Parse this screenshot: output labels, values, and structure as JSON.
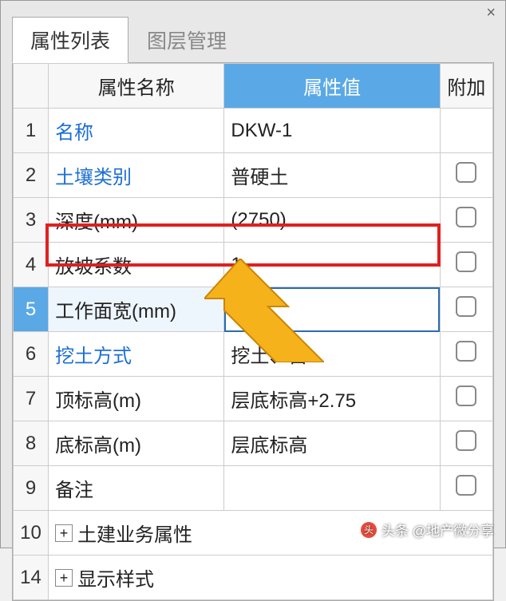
{
  "close_glyph": "×",
  "tabs": {
    "active": "属性列表",
    "inactive": "图层管理"
  },
  "headers": {
    "name": "属性名称",
    "value": "属性值",
    "add": "附加"
  },
  "rows": [
    {
      "n": "1",
      "name": "名称",
      "value": "DKW-1",
      "link": true,
      "checkbox": false
    },
    {
      "n": "2",
      "name": "土壤类别",
      "value": "普硬土",
      "link": true,
      "checkbox": true
    },
    {
      "n": "3",
      "name": "深度(mm)",
      "value": "(2750)",
      "link": false,
      "checkbox": true
    },
    {
      "n": "4",
      "name": "放坡系数",
      "value": "1",
      "link": false,
      "checkbox": true
    },
    {
      "n": "5",
      "name": "工作面宽(mm)",
      "value": "",
      "link": false,
      "checkbox": true,
      "selected": true
    },
    {
      "n": "6",
      "name": "挖土方式",
      "value": "挖土、自...",
      "link": true,
      "checkbox": true
    },
    {
      "n": "7",
      "name": "顶标高(m)",
      "value": "层底标高+2.75",
      "link": false,
      "checkbox": true
    },
    {
      "n": "8",
      "name": "底标高(m)",
      "value": "层底标高",
      "link": false,
      "checkbox": true
    },
    {
      "n": "9",
      "name": "备注",
      "value": "",
      "link": false,
      "checkbox": true
    },
    {
      "n": "10",
      "name": "土建业务属性",
      "value": "",
      "link": false,
      "checkbox": false,
      "expand": true
    },
    {
      "n": "14",
      "name": "显示样式",
      "value": "",
      "link": false,
      "checkbox": false,
      "expand": true
    }
  ],
  "plus_glyph": "+",
  "watermark": {
    "icon": "头",
    "text": "头条 @地产微分享"
  }
}
